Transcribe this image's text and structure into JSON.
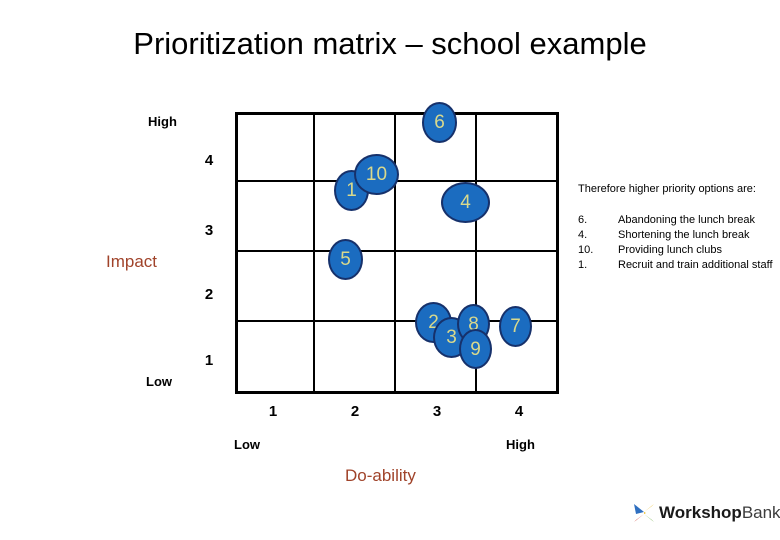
{
  "slide": {
    "title": "Prioritization matrix – school example"
  },
  "matrix": {
    "y_axis": {
      "title": "Impact",
      "high_label": "High",
      "low_label": "Low",
      "ticks": [
        "4",
        "3",
        "2",
        "1"
      ]
    },
    "x_axis": {
      "title": "Do-ability",
      "low_label": "Low",
      "high_label": "High",
      "ticks": [
        "1",
        "2",
        "3",
        "4"
      ]
    },
    "bubble_labels": [
      "6",
      "1",
      "10",
      "4",
      "5",
      "2",
      "3",
      "8",
      "9",
      "7"
    ]
  },
  "notes": {
    "heading": "Therefore higher priority options are:",
    "items": [
      {
        "num": "6.",
        "text": "Abandoning the lunch break"
      },
      {
        "num": "4.",
        "text": "Shortening the lunch break"
      },
      {
        "num": "10.",
        "text": "Providing lunch clubs"
      },
      {
        "num": "1.",
        "text": "Recruit and train additional staff"
      }
    ]
  },
  "footer": {
    "logo_bold": "Workshop",
    "logo_light": "Bank"
  },
  "chart_data": {
    "type": "scatter",
    "title": "Prioritization matrix – school example",
    "xlabel": "Do-ability",
    "ylabel": "Impact",
    "xlim": [
      0,
      4
    ],
    "ylim": [
      0,
      4
    ],
    "xticks": [
      "1",
      "2",
      "3",
      "4"
    ],
    "yticks": [
      "1",
      "2",
      "3",
      "4"
    ],
    "x_low_label": "Low",
    "x_high_label": "High",
    "y_low_label": "Low",
    "y_high_label": "High",
    "grid": true,
    "legend": "none",
    "points": [
      {
        "label": "6",
        "x": 2.6,
        "y": 4.0
      },
      {
        "label": "1",
        "x": 1.7,
        "y": 3.5
      },
      {
        "label": "10",
        "x": 1.9,
        "y": 3.7
      },
      {
        "label": "4",
        "x": 3.0,
        "y": 3.4
      },
      {
        "label": "5",
        "x": 1.6,
        "y": 2.6
      },
      {
        "label": "2",
        "x": 2.8,
        "y": 1.6
      },
      {
        "label": "3",
        "x": 2.9,
        "y": 1.4
      },
      {
        "label": "8",
        "x": 3.1,
        "y": 1.5
      },
      {
        "label": "9",
        "x": 3.1,
        "y": 1.2
      },
      {
        "label": "7",
        "x": 3.5,
        "y": 1.5
      }
    ]
  }
}
